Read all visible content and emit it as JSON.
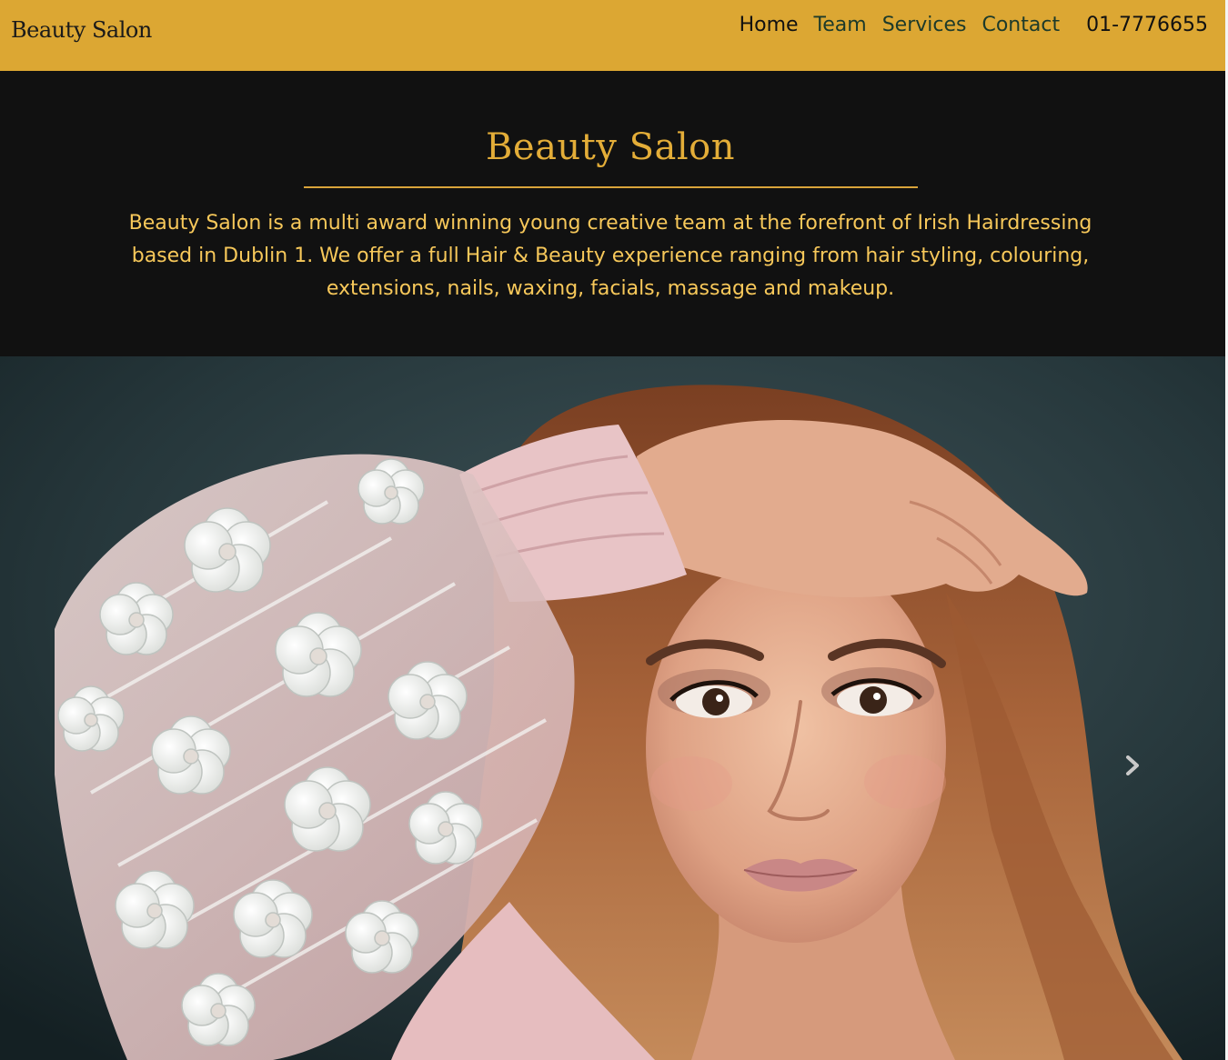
{
  "navbar": {
    "brand": "Beauty Salon",
    "links": [
      {
        "label": "Home"
      },
      {
        "label": "Team"
      },
      {
        "label": "Services"
      },
      {
        "label": "Contact"
      }
    ],
    "phone": "01-7776655",
    "background_color": "#dca733"
  },
  "intro": {
    "title": "Beauty Salon",
    "description": "Beauty Salon is a multi award winning young creative team at the forefront of Irish Hairdressing based in Dublin 1. We offer a full Hair & Beauty experience ranging from hair styling, colouring, extensions, nails, waxing, facials, massage and makeup.",
    "background_color": "#111111",
    "accent_color": "#e3ad38"
  },
  "hero": {
    "image": "portrait-photo",
    "next_control_icon": "chevron-right-icon"
  }
}
